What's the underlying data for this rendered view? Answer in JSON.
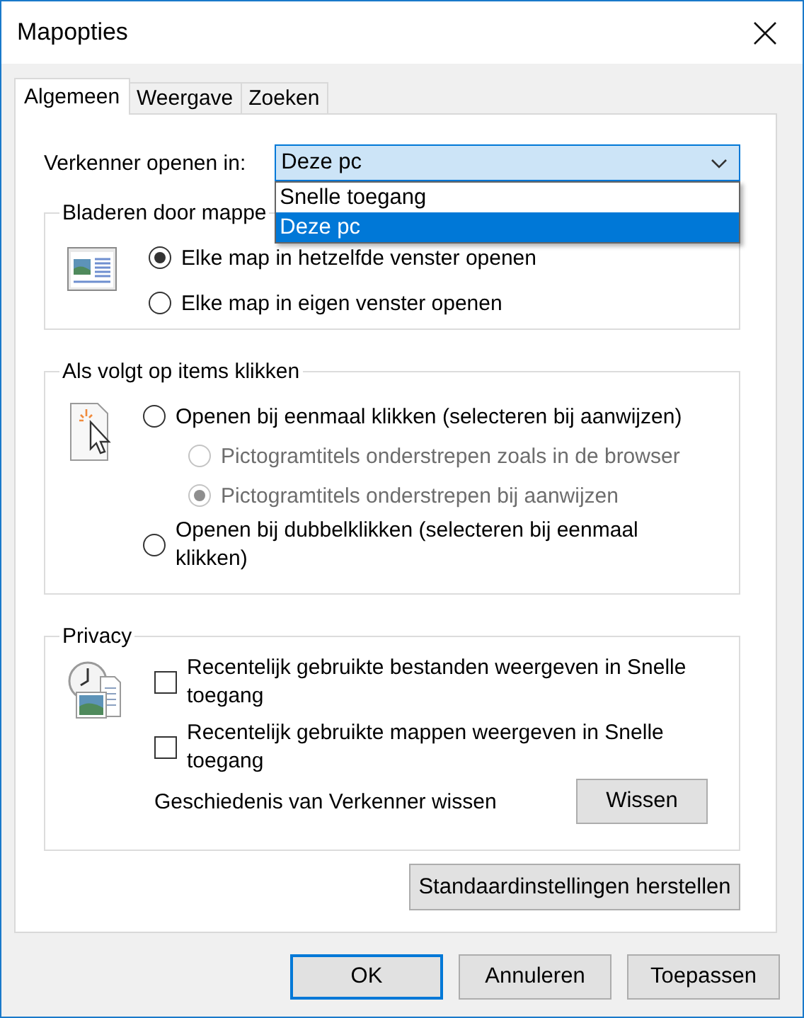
{
  "window": {
    "title": "Mapopties"
  },
  "tabs": [
    {
      "label": "Algemeen",
      "selected": true
    },
    {
      "label": "Weergave",
      "selected": false
    },
    {
      "label": "Zoeken",
      "selected": false
    }
  ],
  "open_in": {
    "label": "Verkenner openen in:",
    "value": "Deze pc",
    "expanded": true,
    "options": [
      {
        "label": "Snelle toegang",
        "selected": false
      },
      {
        "label": "Deze pc",
        "selected": true
      }
    ]
  },
  "browse_group": {
    "title": "Bladeren door mappe",
    "options": [
      {
        "label": "Elke map in hetzelfde venster openen",
        "selected": true,
        "disabled": false
      },
      {
        "label": "Elke map in eigen venster openen",
        "selected": false,
        "disabled": false
      }
    ]
  },
  "click_group": {
    "title": "Als volgt op items klikken",
    "options": [
      {
        "label": "Openen bij eenmaal klikken (selecteren bij aanwijzen)",
        "selected": false,
        "disabled": false,
        "children": [
          {
            "label": "Pictogramtitels onderstrepen zoals in de browser",
            "selected": false,
            "disabled": true
          },
          {
            "label": "Pictogramtitels onderstrepen bij aanwijzen",
            "selected": true,
            "disabled": true
          }
        ]
      },
      {
        "label": "Openen bij dubbelklikken (selecteren bij eenmaal klikken)",
        "selected": false,
        "disabled": false
      }
    ]
  },
  "privacy": {
    "title": "Privacy",
    "checkboxes": [
      {
        "label": "Recentelijk gebruikte bestanden weergeven in Snelle toegang",
        "checked": false
      },
      {
        "label": "Recentelijk gebruikte mappen weergeven in Snelle toegang",
        "checked": false
      }
    ],
    "clear_label": "Geschiedenis van Verkenner wissen",
    "clear_button": "Wissen"
  },
  "restore_button": "Standaardinstellingen herstellen",
  "buttons": [
    {
      "label": "OK",
      "default": true
    },
    {
      "label": "Annuleren",
      "default": false
    },
    {
      "label": "Toepassen",
      "default": false
    }
  ]
}
